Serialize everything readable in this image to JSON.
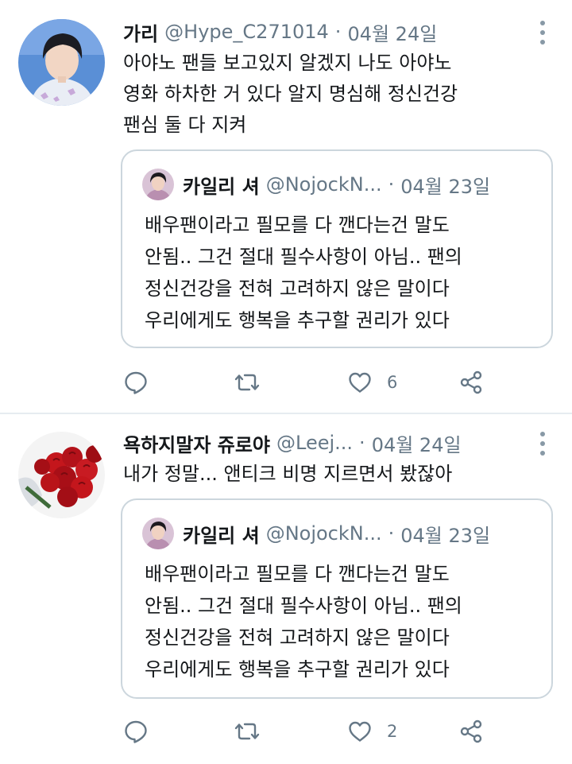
{
  "tweets": [
    {
      "name": "가리",
      "handle": "@Hype_C271014",
      "separator": "·",
      "date": "04월 24일",
      "text_lines": [
        "아야노 팬들 보고있지 알겠지 나도 아야노",
        "영화 하차한 거 있다 알지 명심해 정신건강",
        "팬심 둘 다 지켜"
      ],
      "quote": {
        "name": "카일리 셔",
        "handle": "@NojockN...",
        "separator": "·",
        "date": "04월 23일",
        "text_lines": [
          "배우팬이라고 필모를 다 깬다는건 말도",
          "안됨.. 그건 절대 필수사항이 아님.. 팬의",
          "정신건강을 전혀 고려하지 않은 말이다",
          "우리에게도 행복을 추구할 권리가 있다"
        ]
      },
      "like_count": "6"
    },
    {
      "name": "욕하지말자 쥬로야",
      "handle": "@Leej...",
      "separator": "·",
      "date": "04월 24일",
      "text_lines": [
        "내가 정말... 앤티크 비명 지르면서 봤잖아"
      ],
      "quote": {
        "name": "카일리 셔",
        "handle": "@NojockN...",
        "separator": "·",
        "date": "04월 23일",
        "text_lines": [
          "배우팬이라고 필모를 다 깬다는건 말도",
          "안됨.. 그건 절대 필수사항이 아님.. 팬의",
          "정신건강을 전혀 고려하지 않은 말이다",
          "우리에게도 행복을 추구할 권리가 있다"
        ]
      },
      "like_count": "2"
    }
  ],
  "icons": {
    "reply": "comment-bubble-icon",
    "retweet": "retweet-arrows-icon",
    "like": "heart-outline-icon",
    "share": "share-nodes-icon",
    "more": "vertical-dots-icon"
  },
  "colors": {
    "text": "#14171a",
    "secondary": "#657786",
    "border": "#ccd6dd",
    "separator": "#e6ecf0"
  }
}
